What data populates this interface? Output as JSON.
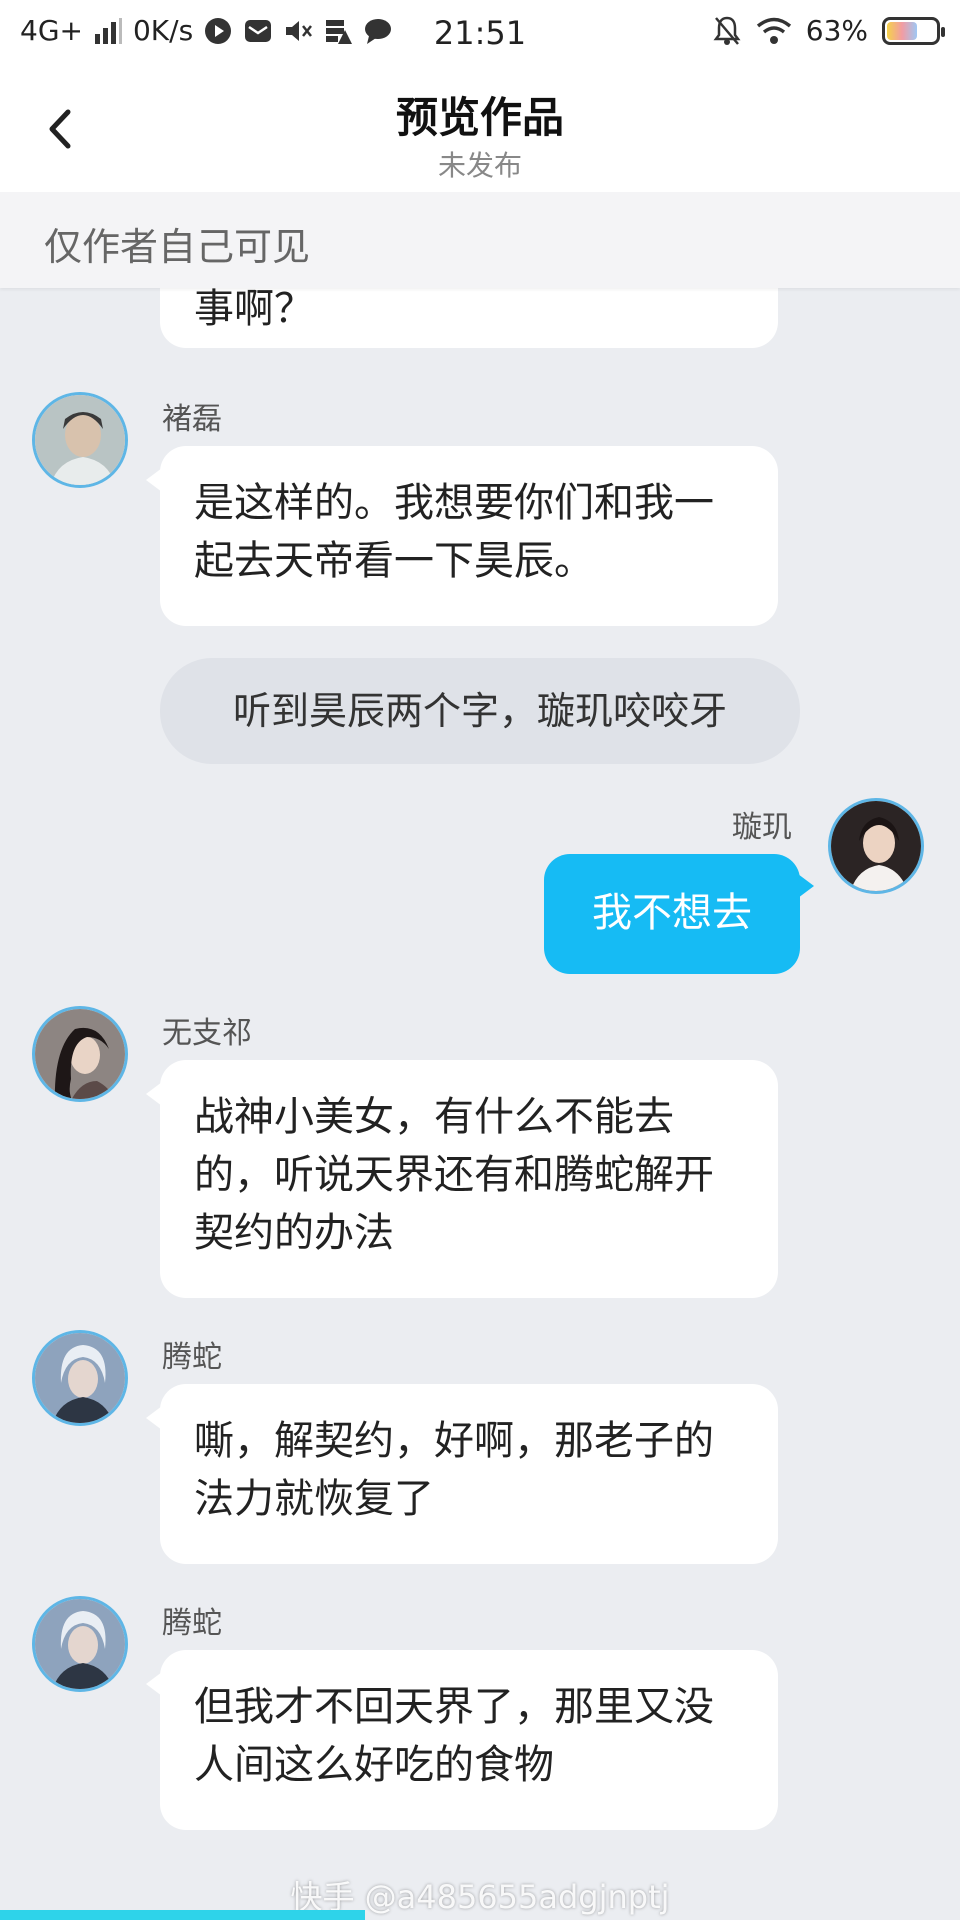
{
  "status_bar": {
    "network": "4G+",
    "speed": "0K/s",
    "time": "21:51",
    "battery": "63%",
    "battery_level": 0.63
  },
  "header": {
    "title": "预览作品",
    "subtitle": "未发布"
  },
  "notice": "仅作者自己可见",
  "messages": [
    {
      "type": "left",
      "speaker": "",
      "text": "事啊？"
    },
    {
      "type": "left",
      "speaker": "褚磊",
      "text": "是这样的。我想要你们和我一起去天帝看一下昊辰。"
    },
    {
      "type": "narration",
      "text": "听到昊辰两个字，璇玑咬咬牙"
    },
    {
      "type": "right",
      "speaker": "璇玑",
      "text": "我不想去"
    },
    {
      "type": "left",
      "speaker": "无支祁",
      "text": "战神小美女，有什么不能去的，听说天界还有和腾蛇解开契约的办法"
    },
    {
      "type": "left",
      "speaker": "腾蛇",
      "text": "嘶，解契约，好啊，那老子的法力就恢复了"
    },
    {
      "type": "left",
      "speaker": "腾蛇",
      "text": "但我才不回天界了，那里又没人间这么好吃的食物"
    }
  ],
  "watermark": "快手 @a485655adgjnptj",
  "playback_progress": 0.38,
  "colors": {
    "accent": "#16bbf4",
    "background": "#ebedf1",
    "avatar_ring": "#5eb6e6"
  }
}
